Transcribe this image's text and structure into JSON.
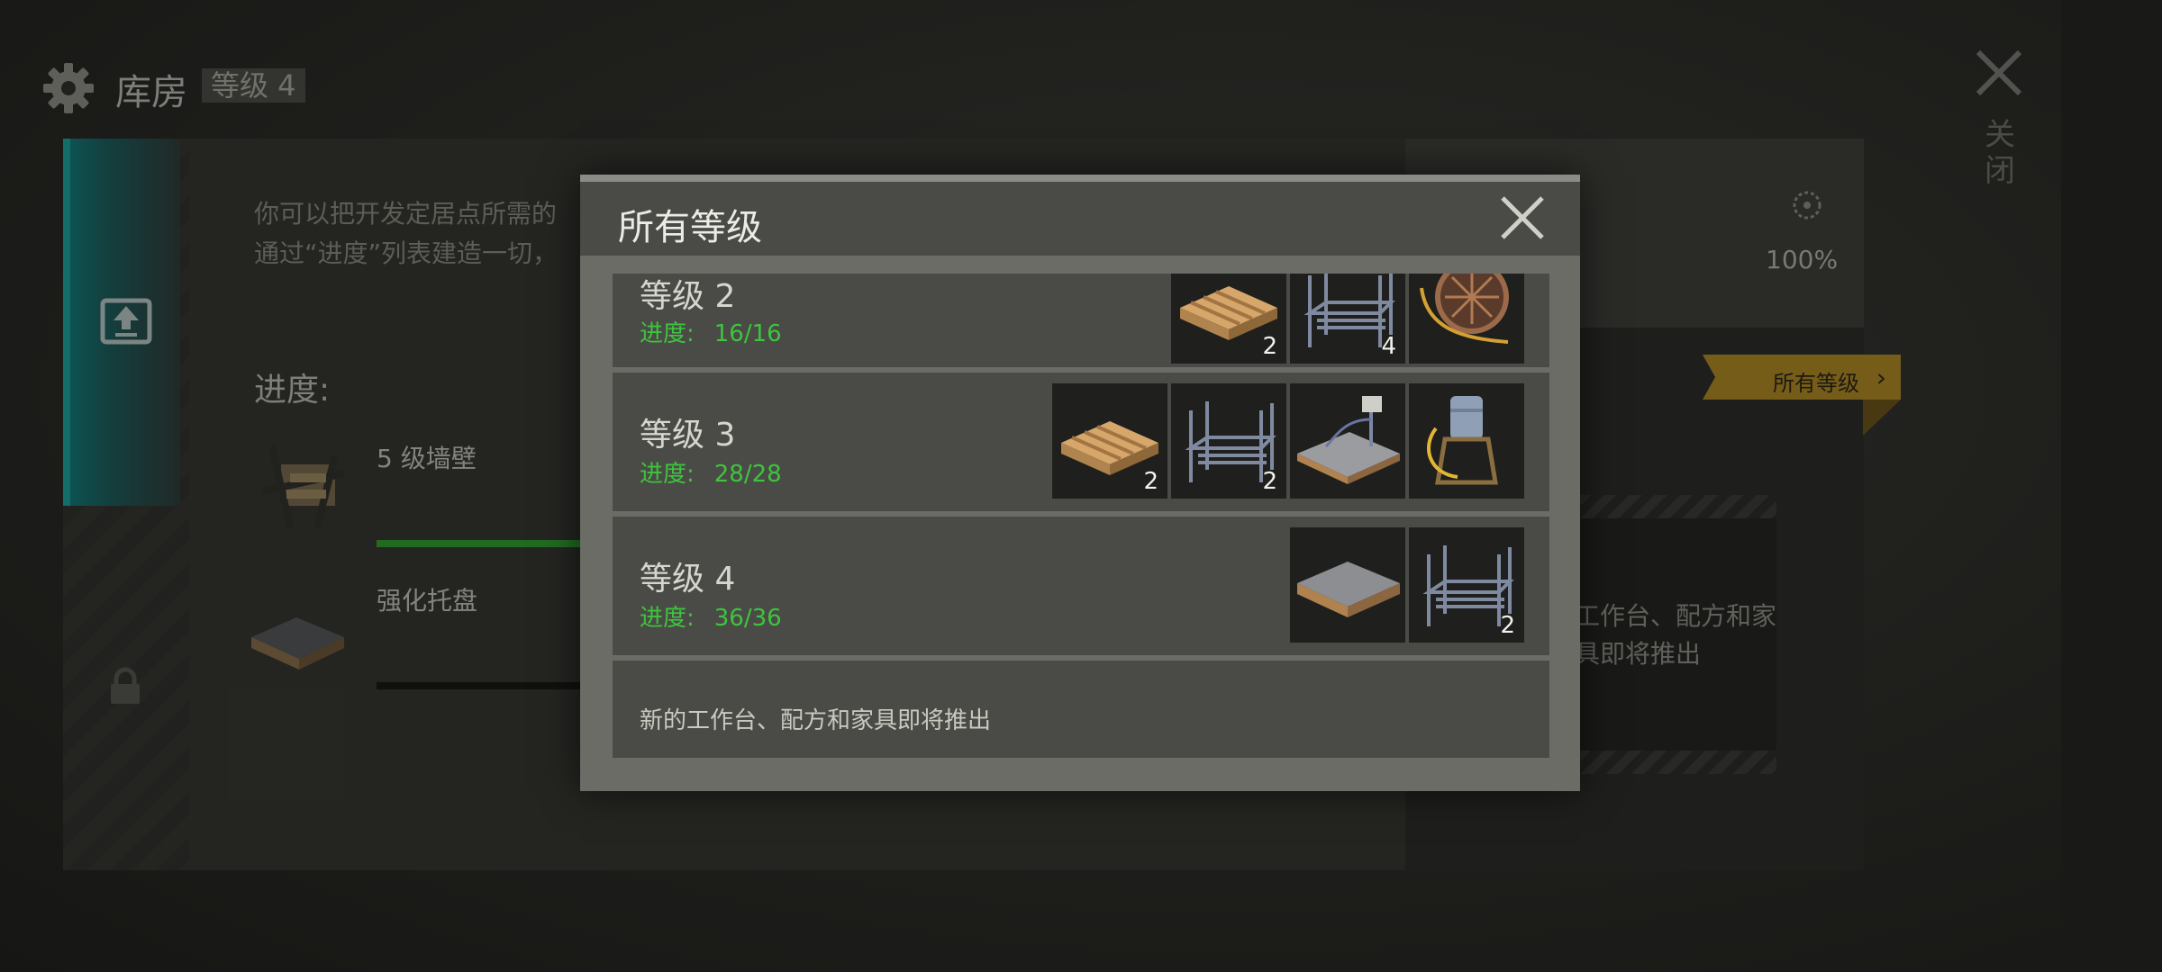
{
  "header": {
    "title": "库房",
    "level": "等级 4"
  },
  "close": {
    "label": "关闭"
  },
  "background": {
    "description": "你可以把开发定居点所需的\n通过“进度”列表建造一切，",
    "progress_title": "进度:",
    "items": [
      {
        "name": "5 级墙壁",
        "icon": "wall-barricade-icon"
      },
      {
        "name": "强化托盘",
        "icon": "reinforced-pallet-icon"
      }
    ],
    "percent": "100%",
    "all_levels_tag": "所有等级",
    "coming_soon_partial": "工作台、配方和家\n具即将推出"
  },
  "modal": {
    "title": "所有等级",
    "progress_label": "进度:",
    "levels": [
      {
        "title": "等级 2",
        "progress": "16/16",
        "items": [
          {
            "icon": "wooden-pallet-icon",
            "count": "2"
          },
          {
            "icon": "metal-rack-icon",
            "count": "4"
          },
          {
            "icon": "cable-reel-icon",
            "count": ""
          }
        ]
      },
      {
        "title": "等级 3",
        "progress": "28/28",
        "items": [
          {
            "icon": "wooden-pallet-icon",
            "count": "2"
          },
          {
            "icon": "metal-rack-icon",
            "count": "2"
          },
          {
            "icon": "scale-platform-icon",
            "count": ""
          },
          {
            "icon": "water-tank-icon",
            "count": ""
          }
        ]
      },
      {
        "title": "等级 4",
        "progress": "36/36",
        "items": [
          {
            "icon": "reinforced-pallet-icon",
            "count": ""
          },
          {
            "icon": "metal-rack-icon",
            "count": "2"
          }
        ]
      }
    ],
    "footer_note": "新的工作台、配方和家具即将推出"
  },
  "colors": {
    "accent_teal": "#1aa3a0",
    "progress_green": "#3ec43e",
    "tag_gold": "#b08a22"
  }
}
